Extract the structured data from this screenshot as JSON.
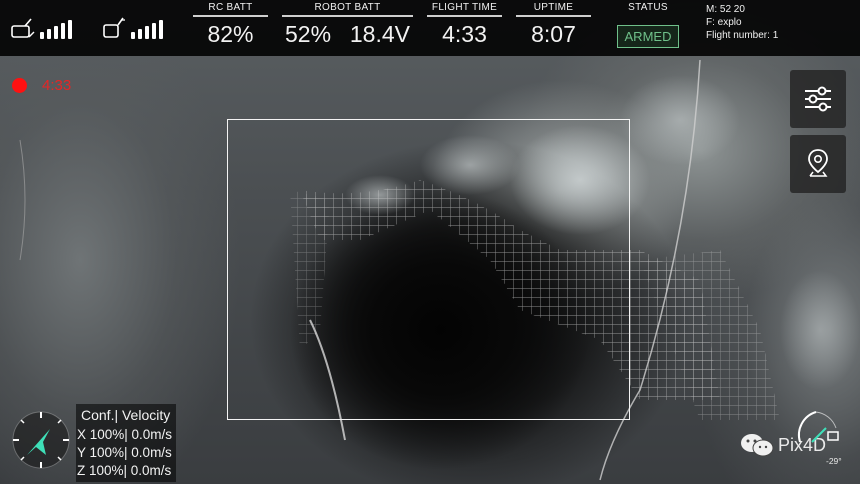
{
  "hud": {
    "rc_batt": {
      "label": "RC BATT",
      "value": "82%"
    },
    "robot_batt": {
      "label": "ROBOT BATT",
      "percent": "52%",
      "voltage": "18.4V"
    },
    "flight_time": {
      "label": "FLIGHT TIME",
      "value": "4:33"
    },
    "uptime": {
      "label": "UPTIME",
      "value": "8:07"
    },
    "status": {
      "label": "STATUS",
      "value": "ARMED",
      "color": "#6fc08a"
    },
    "info": {
      "mode": "M: 52 20",
      "file": "F: explo",
      "flight_number": "Flight number: 1"
    },
    "rc_signal_bars": 5,
    "robot_signal_bars": 5
  },
  "recording": {
    "time": "4:33",
    "color": "#e42626"
  },
  "side_buttons": [
    {
      "icon": "sliders-icon"
    },
    {
      "icon": "location-pin-icon"
    }
  ],
  "velocity": {
    "header": "Conf.| Velocity",
    "rows": [
      "X 100%| 0.0m/s",
      "Y 100%| 0.0m/s",
      "Z 100%| 0.0m/s"
    ]
  },
  "gimbal": {
    "angle": "-29°"
  },
  "watermark": {
    "text": "Pix4D",
    "icon": "wechat-icon"
  }
}
